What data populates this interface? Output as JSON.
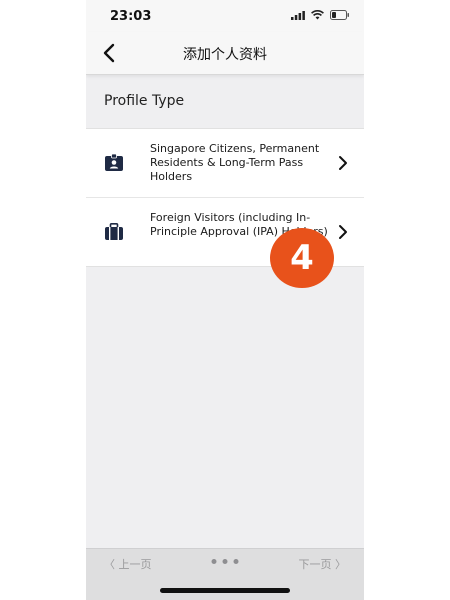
{
  "status_bar": {
    "time": "23:03"
  },
  "nav": {
    "title": "添加个人资料"
  },
  "section": {
    "title": "Profile Type"
  },
  "profile_types": [
    {
      "label": "Singapore Citizens, Permanent Residents & Long-Term Pass Holders",
      "icon": "id-card-icon"
    },
    {
      "label": "Foreign Visitors (including In-Principle Approval (IPA) Holders)",
      "icon": "suitcase-icon"
    }
  ],
  "step_badge": "4",
  "bottom": {
    "prev_label": "〈 上一页",
    "next_label": "下一页 〉"
  },
  "colors": {
    "icon_navy": "#1f2a44",
    "badge_orange": "#e8521b"
  }
}
